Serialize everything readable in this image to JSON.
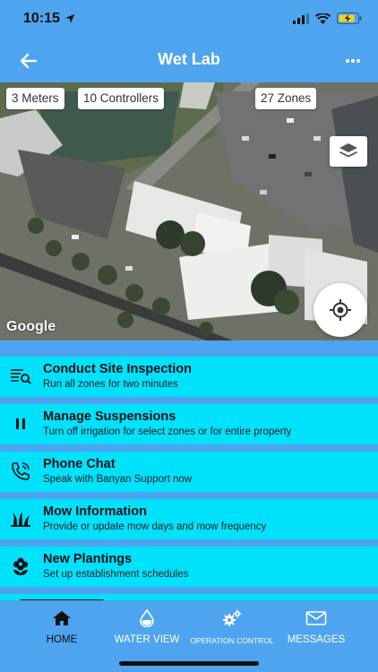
{
  "status": {
    "time": "10:15"
  },
  "header": {
    "title": "Wet Lab"
  },
  "map": {
    "chips": {
      "meters": "3 Meters",
      "controllers": "10 Controllers",
      "zones": "27 Zones"
    },
    "attribution": "Google"
  },
  "actions": [
    {
      "title": "Conduct Site Inspection",
      "subtitle": "Run all zones for two minutes",
      "icon": "inspection-list-icon"
    },
    {
      "title": "Manage Suspensions",
      "subtitle": "Turn off irrigation for select zones or for entire property",
      "icon": "pause-icon"
    },
    {
      "title": "Phone Chat",
      "subtitle": "Speak with Banyan Support now",
      "icon": "phone-icon"
    },
    {
      "title": "Mow Information",
      "subtitle": "Provide or update mow days and mow frequency",
      "icon": "grass-icon"
    },
    {
      "title": "New Plantings",
      "subtitle": "Set up establishment schedules",
      "icon": "flower-icon"
    }
  ],
  "tabs": [
    {
      "label": "HOME",
      "icon": "home-icon",
      "active": true
    },
    {
      "label": "WATER VIEW",
      "icon": "water-drop-icon"
    },
    {
      "label": "OPERATION CONTROL",
      "icon": "gears-icon"
    },
    {
      "label": "MESSAGES",
      "icon": "mail-icon"
    }
  ],
  "colors": {
    "header_bg": "#4ea4ee",
    "action_bg": "#00e1fc",
    "active_tab": "#111111"
  }
}
